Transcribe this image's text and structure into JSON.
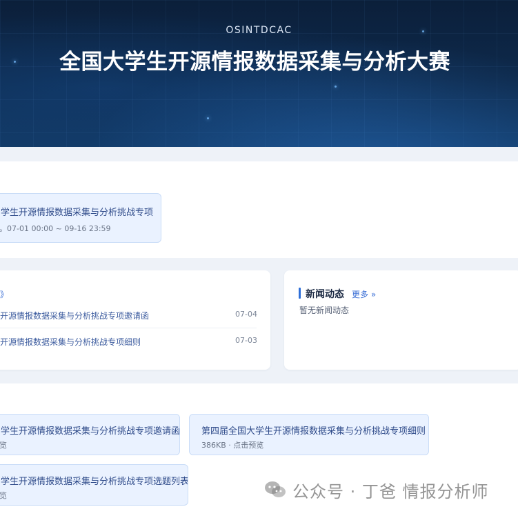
{
  "hero": {
    "subtitle": "OSINTDCAC",
    "title": "全国大学生开源情报数据采集与分析大赛"
  },
  "track_card": {
    "title": "学生开源情报数据采集与分析挑战专项",
    "time": "。07-01 00:00 ~ 09-16 23:59"
  },
  "notices": {
    "more_label": "更多 »",
    "more_partial": "》",
    "items": [
      {
        "title": "开源情报数据采集与分析挑战专项邀请函",
        "date": "07-04"
      },
      {
        "title": "开源情报数据采集与分析挑战专项细则",
        "date": "07-03"
      }
    ]
  },
  "news": {
    "title": "新闻动态",
    "more_label": "更多 »",
    "empty_text": "暂无新闻动态"
  },
  "files": [
    {
      "title": "学生开源情报数据采集与分析挑战专项邀请函",
      "meta": "览"
    },
    {
      "title": "第四届全国大学生开源情报数据采集与分析挑战专项细则",
      "meta": "386KB · 点击预览"
    },
    {
      "title": "学生开源情报数据采集与分析挑战专项选题列表",
      "meta": "览"
    }
  ],
  "watermark": {
    "text": "公众号 · 丁爸 情报分析师",
    "icon": "wechat-icon"
  },
  "colors": {
    "accent": "#2e6fd8",
    "card_bg": "#eaf2ff",
    "hero_bg": "#0e2a4c"
  }
}
